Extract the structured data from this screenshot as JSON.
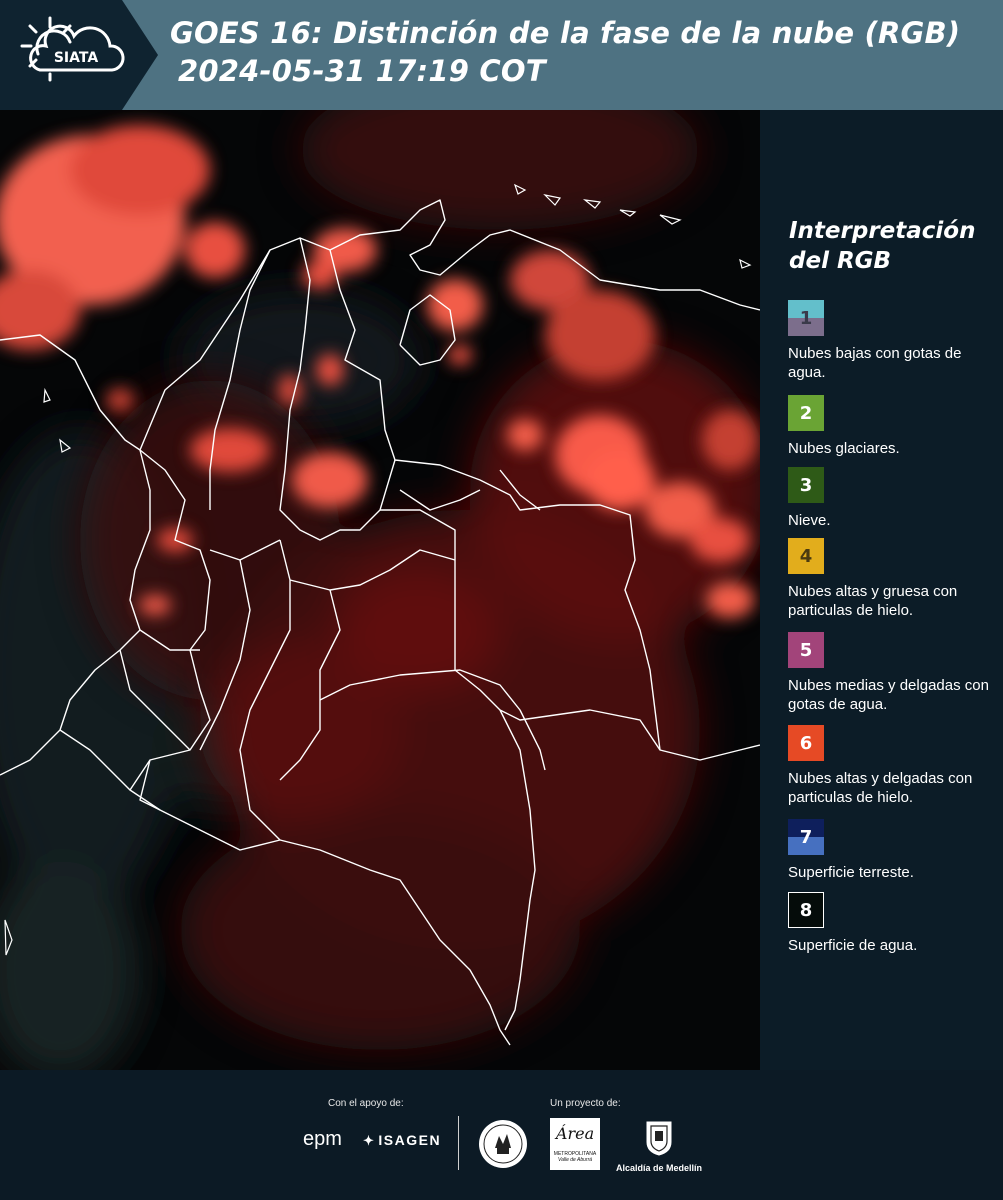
{
  "header": {
    "logo_text": "SIATA",
    "title_line1": "GOES 16: Distinción de la fase de la nube (RGB)",
    "title_line2": "2024-05-31 17:19 COT"
  },
  "legend": {
    "title_line1": "Interpretación",
    "title_line2": "del RGB",
    "items": [
      {
        "number": "1",
        "label": "Nubes bajas con gotas de agua.",
        "color_top": "#63bfcb",
        "color_bottom": "#7c6e8c",
        "text_color": "#3a3a4a"
      },
      {
        "number": "2",
        "label": "Nubes glaciares.",
        "color_top": "#6aa434",
        "color_bottom": "#6aa434",
        "text_color": "#ffffff"
      },
      {
        "number": "3",
        "label": "Nieve.",
        "color_top": "#2e5a17",
        "color_bottom": "#2e5a17",
        "text_color": "#ffffff"
      },
      {
        "number": "4",
        "label": "Nubes altas y gruesa con particulas de hielo.",
        "color_top": "#e2ad1c",
        "color_bottom": "#e2ad1c",
        "text_color": "#4a3a10"
      },
      {
        "number": "5",
        "label": "Nubes medias y delgadas con gotas de agua.",
        "color_top": "#a2447a",
        "color_bottom": "#a2447a",
        "text_color": "#ffffff"
      },
      {
        "number": "6",
        "label": "Nubes altas y delgadas con particulas de hielo.",
        "color_top": "#e64a25",
        "color_bottom": "#e64a25",
        "text_color": "#ffffff"
      },
      {
        "number": "7",
        "label": "Superficie terreste.",
        "color_top": "#0e1f5c",
        "color_bottom": "#4670c0",
        "text_color": "#ffffff"
      },
      {
        "number": "8",
        "label": "Superficie de agua.",
        "color_top": "#050c0a",
        "color_bottom": "#050c0a",
        "text_color": "#ffffff"
      }
    ]
  },
  "footer": {
    "support_label": "Con el apoyo de:",
    "project_label": "Un proyecto de:",
    "sponsor_1": "epm",
    "sponsor_2": "ISAGEN",
    "area_name": "Área",
    "area_sub1": "METROPOLITANA",
    "area_sub2": "Valle de Aburrá",
    "alcaldia": "Alcaldía de Medellín"
  }
}
